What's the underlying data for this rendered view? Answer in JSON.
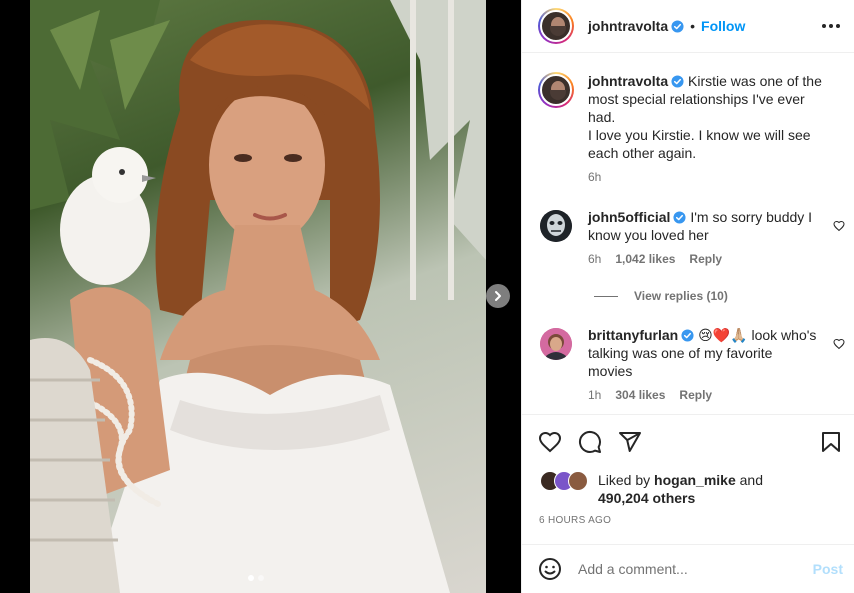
{
  "post": {
    "username": "johntravolta",
    "follow_label": "Follow",
    "separator": "•"
  },
  "media": {
    "slide_count": 2,
    "active_slide": 1,
    "next_icon": "chevron-right-icon"
  },
  "caption": {
    "username": "johntravolta",
    "text": "Kirstie was one of the most special relationships I've ever had.",
    "text2": "I love you Kirstie. I know we will see each other again.",
    "time": "6h"
  },
  "comments": [
    {
      "username": "john5official",
      "text": "I'm so sorry buddy I know you loved her",
      "time": "6h",
      "likes": "1,042 likes",
      "reply_label": "Reply",
      "view_replies": "View replies (10)"
    },
    {
      "username": "brittanyfurlan",
      "emoji": "😢❤️🙏🏼",
      "text": " look who's talking was one of my favorite movies",
      "time": "1h",
      "likes": "304 likes",
      "reply_label": "Reply"
    }
  ],
  "actions": {
    "icons": [
      "heart-icon",
      "comment-icon",
      "share-icon",
      "bookmark-icon"
    ]
  },
  "likes": {
    "prefix": "Liked by ",
    "user": "hogan_mike",
    "and": " and",
    "others": "490,204 others"
  },
  "time_ago": "6 HOURS AGO",
  "add_comment": {
    "placeholder": "Add a comment...",
    "post_label": "Post"
  },
  "colors": {
    "accent": "#0095f6",
    "post_disabled": "#b2dffc",
    "verified": "#3897f0"
  }
}
